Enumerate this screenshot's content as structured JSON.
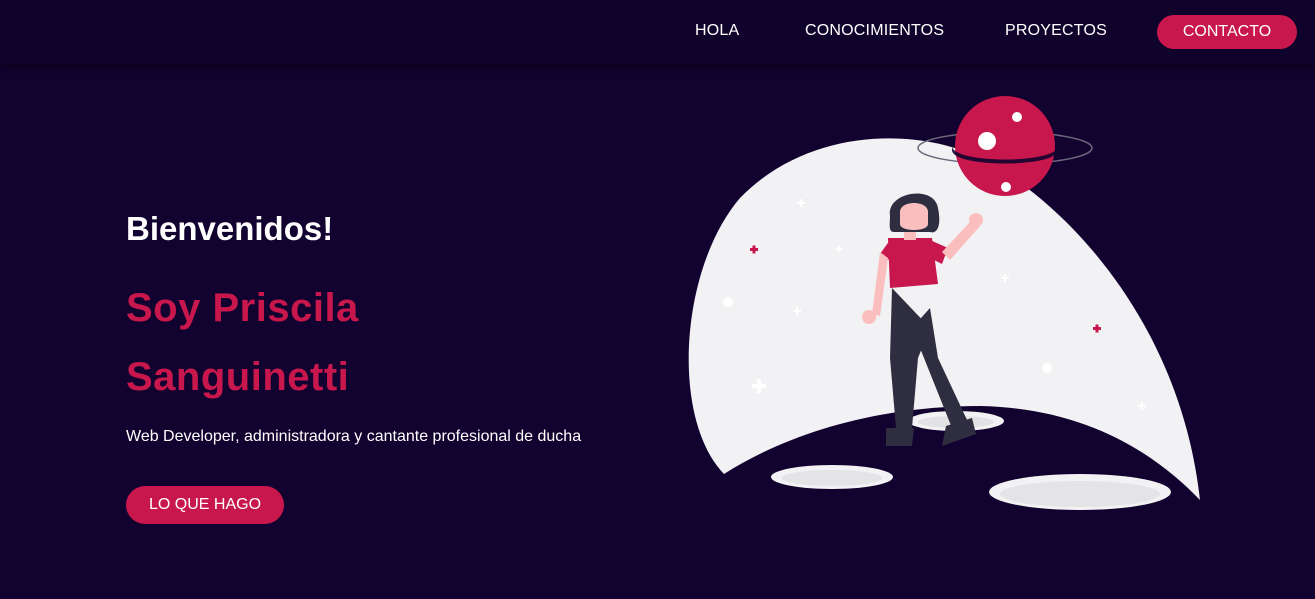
{
  "nav": {
    "links": [
      {
        "label": "HOLA"
      },
      {
        "label": "CONOCIMIENTOS"
      },
      {
        "label": "PROYECTOS"
      }
    ],
    "contact_label": "CONTACTO"
  },
  "hero": {
    "greeting": "Bienvenidos!",
    "name_line1": "Soy Priscila",
    "name_line2": "Sanguinetti",
    "description": "Web Developer, administradora y cantante profesional de ducha",
    "cta_label": "LO QUE HAGO"
  },
  "illustration": {
    "subject": "woman reaching for planet",
    "icons": [
      "planet-icon",
      "star-icon",
      "sparkle-icon"
    ]
  },
  "colors": {
    "background": "#12022f",
    "navbar": "#10032b",
    "accent": "#c8174c",
    "text": "#ffffff",
    "moon": "#f2f1f3"
  }
}
